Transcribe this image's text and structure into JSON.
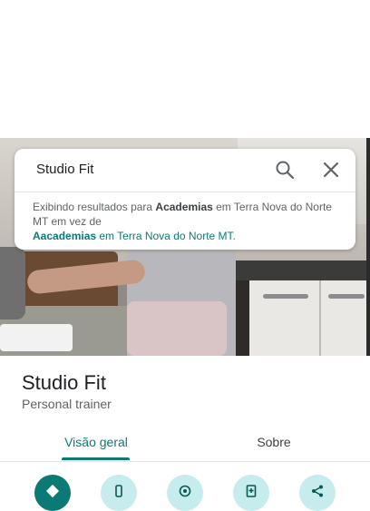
{
  "search": {
    "query": "Studio Fit",
    "note_prefix": "Exibindo resultados para ",
    "corrected_term": "Academias",
    "note_middle": " em Terra Nova do Norte MT em vez de",
    "original_term": "Aacademias",
    "note_suffix": " em Terra Nova do Norte MT",
    "note_end": "."
  },
  "place": {
    "name": "Studio Fit",
    "category": "Personal trainer"
  },
  "tabs": [
    {
      "label": "Visão geral",
      "active": true
    },
    {
      "label": "Sobre",
      "active": false
    }
  ],
  "actions": [
    "directions-icon",
    "phone-icon",
    "location-icon",
    "save-icon",
    "share-icon"
  ],
  "colors": {
    "accent": "#0b7a74",
    "action_bg": "#c6ecee"
  }
}
